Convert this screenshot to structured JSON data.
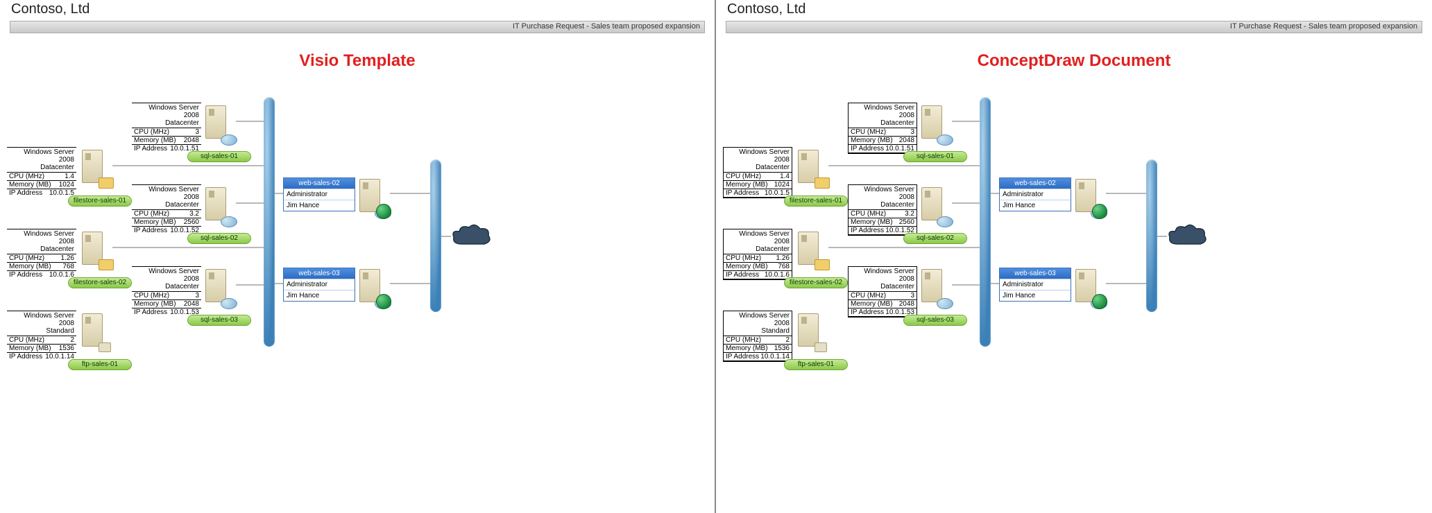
{
  "company": "Contoso, Ltd",
  "titlebar": "IT Purchase Request - Sales team proposed expansion",
  "panes": [
    {
      "label": "Visio Template",
      "spec_boxed": false
    },
    {
      "label": "ConceptDraw Document",
      "spec_boxed": true
    }
  ],
  "spec_labels": {
    "cpu": "CPU (MHz)",
    "mem": "Memory (MB)",
    "ip": "IP Address"
  },
  "servers_col1": [
    {
      "name": "filestore-sales-01",
      "os1": "Windows Server 2008",
      "os2": "Datacenter",
      "cpu": "1.4",
      "mem": "1024",
      "ip": "10.0.1.5",
      "kind": "file"
    },
    {
      "name": "filestore-sales-02",
      "os1": "Windows Server 2008",
      "os2": "Datacenter",
      "cpu": "1.26",
      "mem": "768",
      "ip": "10.0.1.6",
      "kind": "file"
    },
    {
      "name": "ftp-sales-01",
      "os1": "Windows Server 2008",
      "os2": "Standard",
      "cpu": "2",
      "mem": "1536",
      "ip": "10.0.1.14",
      "kind": "std"
    }
  ],
  "servers_col2": [
    {
      "name": "sql-sales-01",
      "os1": "Windows Server 2008",
      "os2": "Datacenter",
      "cpu": "3",
      "mem": "2048",
      "ip": "10.0.1.51",
      "kind": "sql"
    },
    {
      "name": "sql-sales-02",
      "os1": "Windows Server 2008",
      "os2": "Datacenter",
      "cpu": "3.2",
      "mem": "2560",
      "ip": "10.0.1.52",
      "kind": "sql"
    },
    {
      "name": "sql-sales-03",
      "os1": "Windows Server 2008",
      "os2": "Datacenter",
      "cpu": "3",
      "mem": "2048",
      "ip": "10.0.1.53",
      "kind": "sql"
    }
  ],
  "web": [
    {
      "name": "web-sales-02",
      "role": "Administrator",
      "owner": "Jim Hance"
    },
    {
      "name": "web-sales-03",
      "role": "Administrator",
      "owner": "Jim Hance"
    }
  ]
}
